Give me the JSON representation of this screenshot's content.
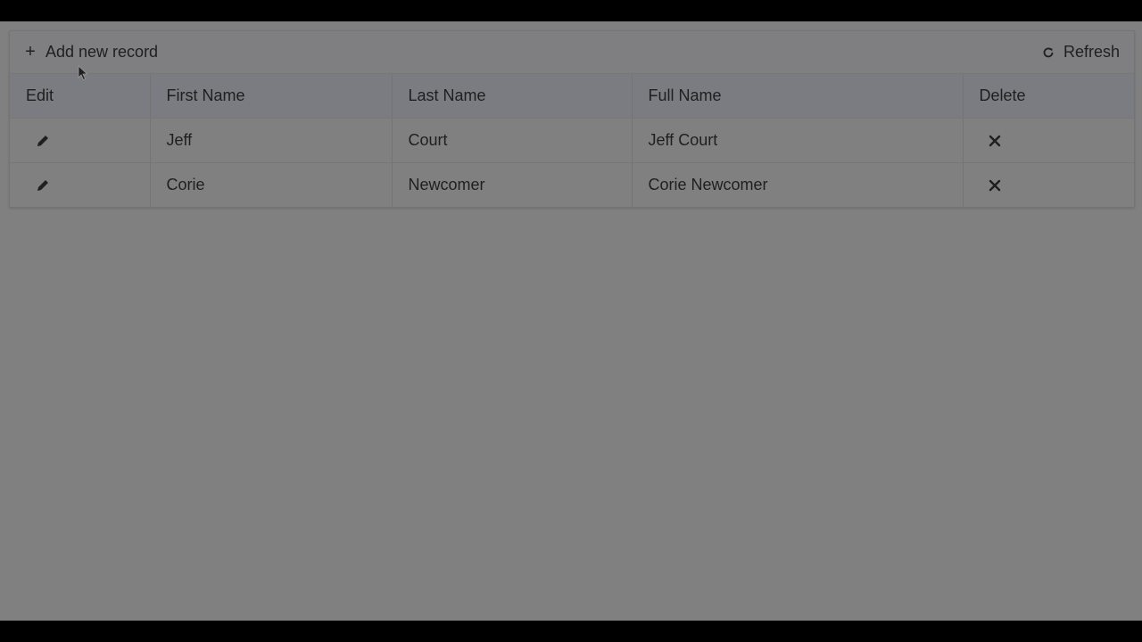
{
  "toolbar": {
    "add_label": "Add new record",
    "add_icon": "plus-icon",
    "refresh_label": "Refresh",
    "refresh_icon": "refresh-icon"
  },
  "table": {
    "headers": [
      "Edit",
      "First Name",
      "Last Name",
      "Full Name",
      "Delete"
    ],
    "rows": [
      {
        "first": "Jeff",
        "last": "Court",
        "full": "Jeff Court"
      },
      {
        "first": "Corie",
        "last": "Newcomer",
        "full": "Corie Newcomer"
      }
    ]
  },
  "icons": {
    "edit": "pencil-icon",
    "delete": "close-icon"
  },
  "colors": {
    "overlay": "#808080",
    "header_bg": "#7b7b82",
    "text": "#1f1f1f"
  }
}
